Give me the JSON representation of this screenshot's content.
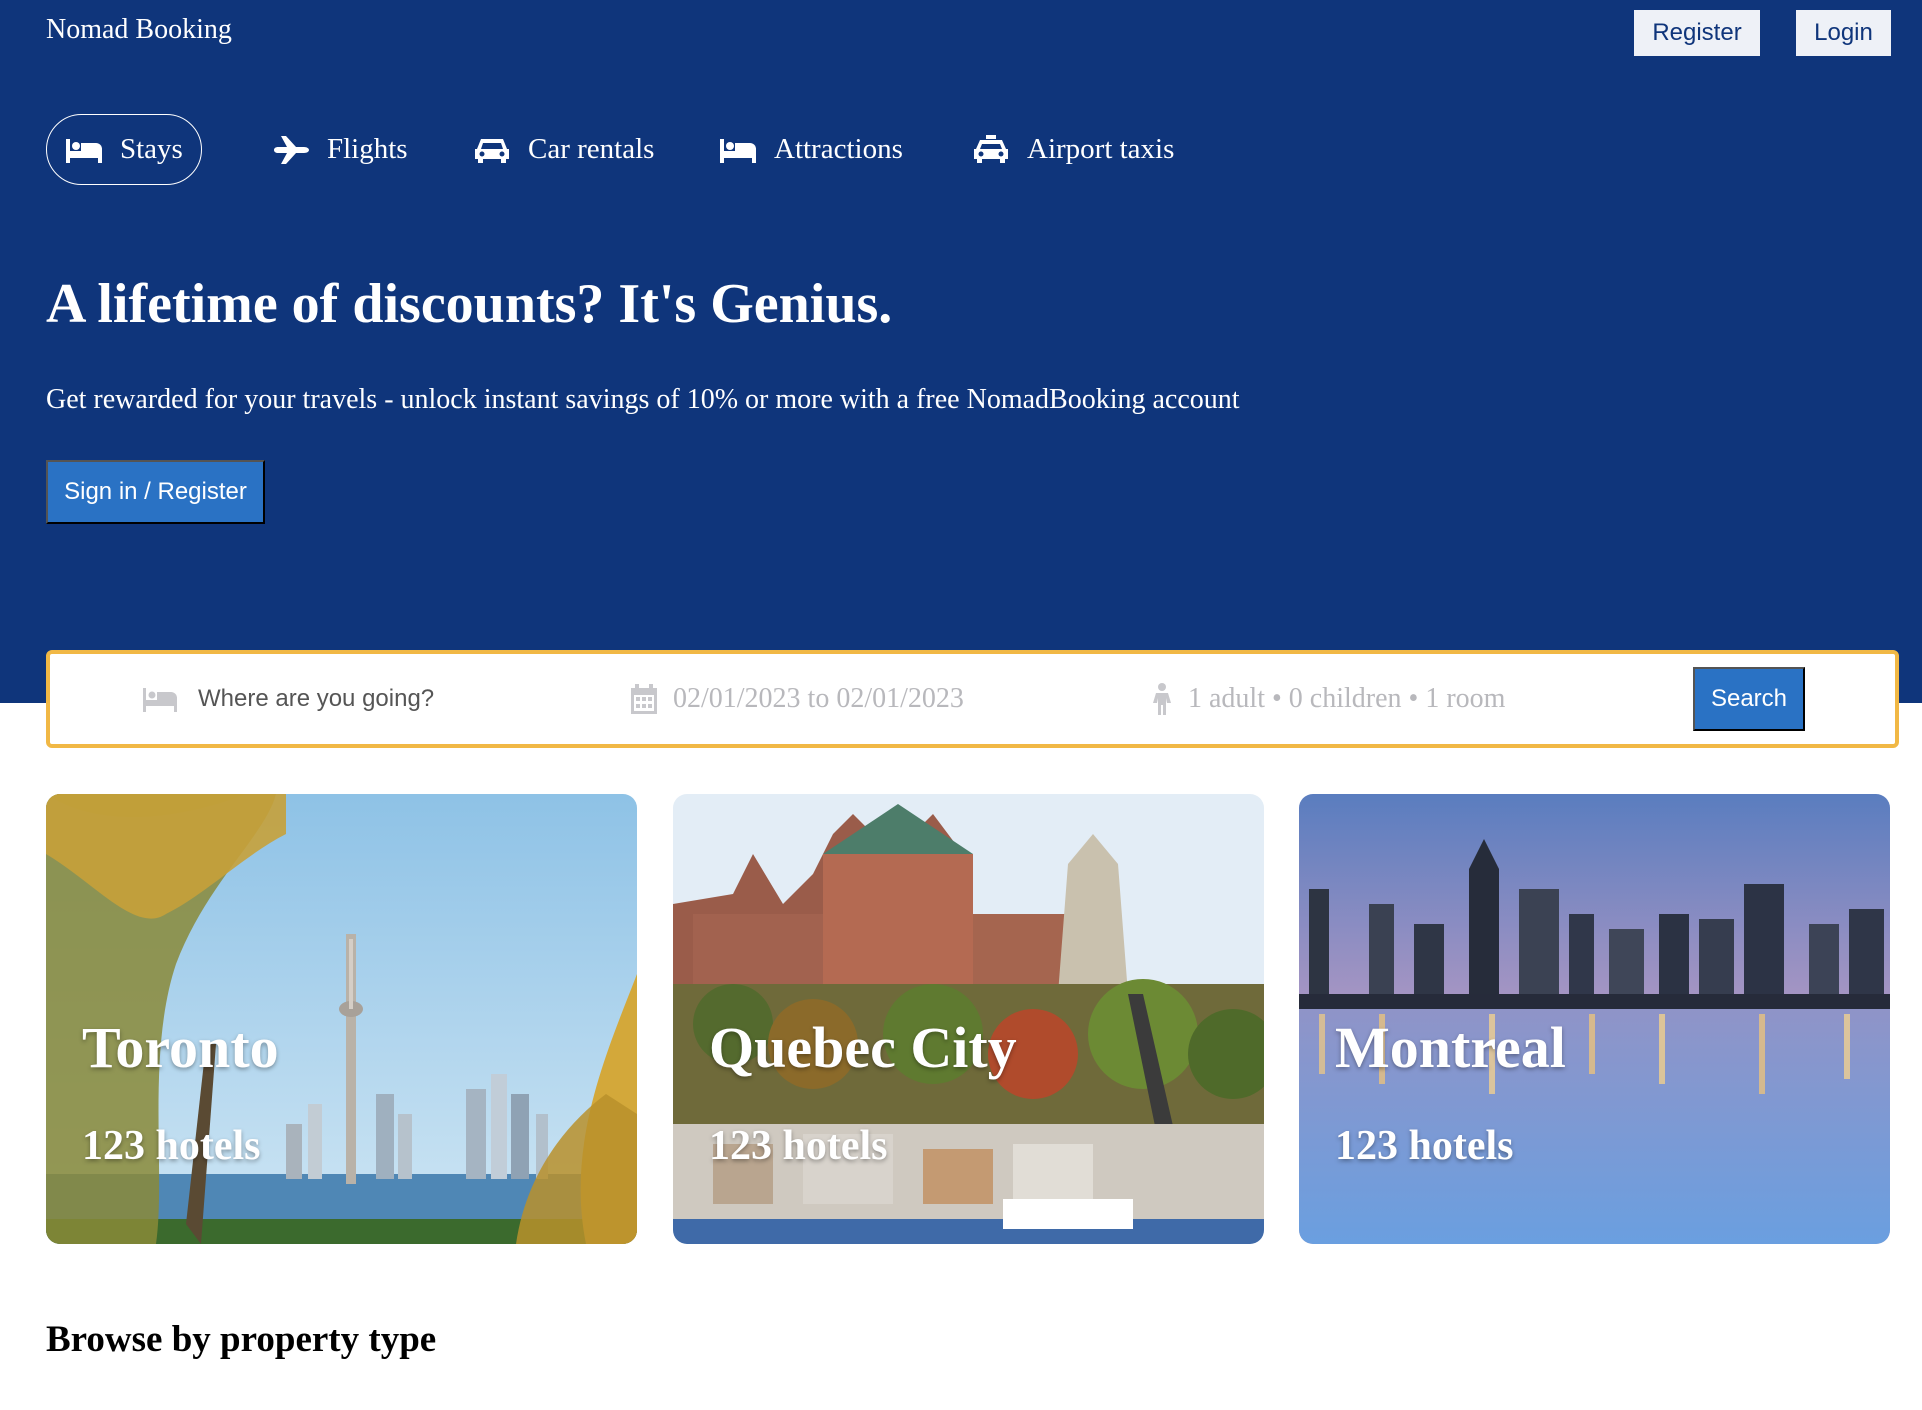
{
  "app": {
    "brand": "Nomad Booking"
  },
  "auth": {
    "register_label": "Register",
    "login_label": "Login"
  },
  "nav": {
    "items": [
      {
        "label": "Stays",
        "icon": "bed-icon",
        "active": true
      },
      {
        "label": "Flights",
        "icon": "plane-icon",
        "active": false
      },
      {
        "label": "Car rentals",
        "icon": "car-icon",
        "active": false
      },
      {
        "label": "Attractions",
        "icon": "bed-icon",
        "active": false
      },
      {
        "label": "Airport taxis",
        "icon": "taxi-icon",
        "active": false
      }
    ]
  },
  "hero": {
    "title": "A lifetime of discounts? It's Genius.",
    "subtitle": "Get rewarded for your travels - unlock instant savings of 10% or more with a free NomadBooking account",
    "cta_label": "Sign in / Register"
  },
  "search": {
    "destination_placeholder": "Where are you going?",
    "dates": "02/01/2023 to 02/01/2023",
    "guests": "1 adult • 0 children • 1 room",
    "button_label": "Search",
    "border_color": "#f1b845"
  },
  "featured": [
    {
      "city": "Toronto",
      "count": "123 hotels"
    },
    {
      "city": "Quebec City",
      "count": "123 hotels"
    },
    {
      "city": "Montreal",
      "count": "123 hotels"
    }
  ],
  "browse": {
    "title": "Browse by property type"
  },
  "colors": {
    "header_bg": "#0f357b",
    "accent": "#2a72c4",
    "search_border": "#f1b845"
  }
}
